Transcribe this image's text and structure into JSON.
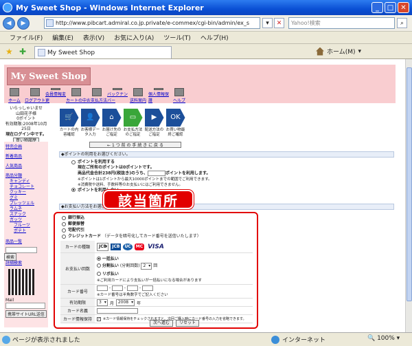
{
  "window": {
    "title": "My Sweet Shop - Windows Internet Explorer",
    "minimize": "_",
    "maximize": "□",
    "close": "✕"
  },
  "address": {
    "url": "http://www.pibcart.admiral.co.jp.private/e-commex/cgi-bin/admin/ex_s",
    "search_placeholder": "Yahoo!検索"
  },
  "menu": [
    "ファイル(F)",
    "編集(E)",
    "表示(V)",
    "お気に入り(A)",
    "ツール(T)",
    "ヘルプ(H)"
  ],
  "tab": {
    "label": "My Sweet Shop",
    "home_label": "ホーム(M)"
  },
  "site": {
    "logo_text": "My Sweet Shop",
    "nav": [
      "ホーム",
      "ログアウト",
      "会員情報変更",
      "カートの中",
      "お支払方法",
      "バックナンバー",
      "送料案内",
      "個人情報保護",
      "ヘルプ"
    ]
  },
  "user": {
    "greeting": "いらっしゃいませ",
    "name": "山田花子様",
    "points": "0ポイント",
    "login_date": "有効期限:2008年10月25日",
    "status": "現在ログイン中です。",
    "history_button": "買い物履歴"
  },
  "sidebar": {
    "links": [
      "特売企画",
      "新着商品",
      "人気商品"
    ],
    "category_title": "商品分類",
    "categories": [
      "キャンディ",
      "チョコレート",
      "クッキー",
      "グミ",
      "プレッツェル",
      "ラムネ",
      "スナック",
      "ガッツ"
    ],
    "subcategories": [
      "フルーツ",
      "ポテト"
    ],
    "list_link": "商品一覧",
    "search_button": "検索",
    "detail_link": "詳細検索",
    "mail_label": "Mail",
    "mobile_button": "携帯サイトURL送信"
  },
  "steps": [
    {
      "label": "カートの内容確認"
    },
    {
      "label": "お客様データ入力"
    },
    {
      "label": "お届け先のご指定"
    },
    {
      "label": "お支払方法のご指定"
    },
    {
      "label": "配送方法のご指定"
    },
    {
      "label": "お買い物最終ご確認"
    }
  ],
  "back_button": "← 1 つ 前 の 手 続 き に 戻 る",
  "points_section": {
    "heading": "◆ポイントの利用をお選びください。",
    "use_label": "ポイントを利用する",
    "current": "現在ご所有のポイントは0ポイントです。",
    "amount_label": "商品代金合計238円(税抜き)のうち、",
    "amount_suffix": "ポイントを利用します。",
    "note1": "※ポイントは1ポイントから最大10000ポイントまでの範囲でご利用できます。",
    "note2": "※消費税や送料、手数料等のお支払いにはご利用できません。",
    "no_use_label": "ポイントを利用しない"
  },
  "badge_text": "該当箇所",
  "payment_section": {
    "heading": "◆お支払い方法をお選びください。",
    "options": [
      "銀行振込",
      "郵便振替",
      "宅配代引",
      "クレジットカード"
    ],
    "credit_note": "（データを暗号化してカード番号を送信いたします）",
    "card_type_label": "カードの種類",
    "card_type_value": "JCB",
    "pay_count_label": "お支払い回数",
    "lump": "一括払い",
    "split": "分割払い",
    "split_count_label": "分割回数",
    "split_value": "2",
    "split_suffix": "回",
    "revolving": "リボ払い",
    "pay_note": "※ご利用カードにより支払いが一括払いになる場合があります",
    "card_number_label": "カード番号",
    "card_number_note": "※カード番号は半角数字でご記入ください",
    "expiry_label": "有効期限",
    "expiry_month": "3",
    "month_suffix": "月",
    "expiry_year": "2008",
    "year_suffix": "年",
    "holder_label": "カード名義",
    "save_label": "カード情報保持",
    "save_note": "※カード情報保持をチェックされますと、次回ご購入時にカード番号の入力を省略できます。"
  },
  "submit": {
    "next": "次へ進む",
    "reset": "リセット"
  },
  "status": {
    "text": "ページが表示されました",
    "zone": "インターネット",
    "zoom": "100%"
  },
  "colors": {
    "accent_red": "#e20000",
    "site_pink": "#f9cdd0",
    "step_blue": "#1c4f9a"
  }
}
